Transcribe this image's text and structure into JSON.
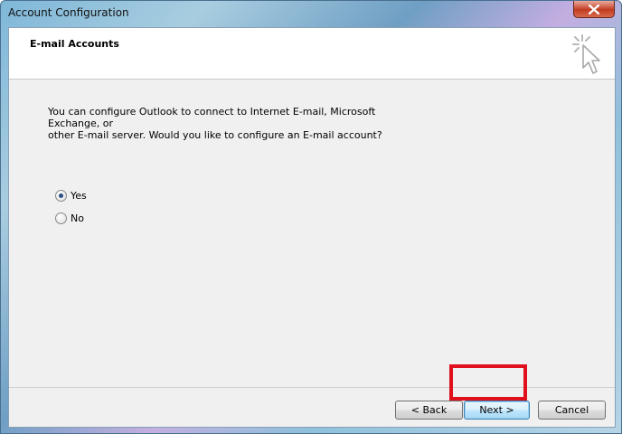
{
  "window": {
    "title": "Account Configuration"
  },
  "header": {
    "title": "E-mail Accounts"
  },
  "body": {
    "message": "You can configure Outlook to connect to Internet E-mail, Microsoft Exchange, or\nother E-mail server. Would you like to configure an E-mail account?",
    "options": [
      {
        "label": "Yes",
        "selected": true
      },
      {
        "label": "No",
        "selected": false
      }
    ]
  },
  "footer": {
    "back_label": "< Back",
    "next_label": "Next >",
    "cancel_label": "Cancel"
  },
  "colors": {
    "highlight": "#e0101c",
    "close_button": "#c7462f"
  }
}
